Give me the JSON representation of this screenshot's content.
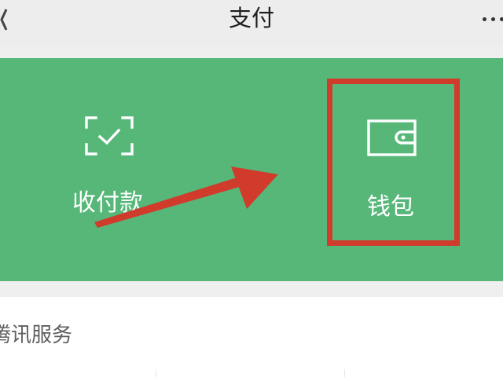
{
  "header": {
    "title": "支付"
  },
  "green_panel": {
    "background": "#56b779",
    "tiles": [
      {
        "label": "收付款",
        "icon": "scan-check-icon"
      },
      {
        "label": "钱包",
        "icon": "wallet-icon"
      }
    ]
  },
  "annotation": {
    "color": "#d03b2c",
    "highlight": "wallet",
    "arrow_direction": "points-right-to-wallet"
  },
  "services": {
    "title": "腾讯服务"
  }
}
